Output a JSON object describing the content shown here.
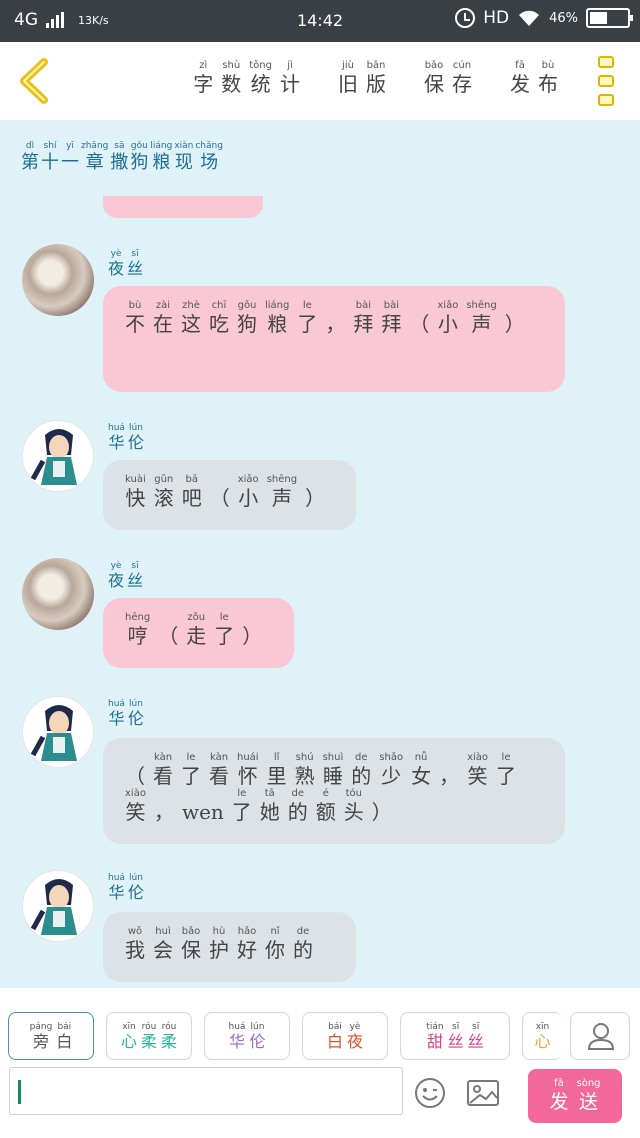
{
  "status": {
    "network": "4G",
    "speed": "13K/s",
    "time": "14:42",
    "hd": "HD",
    "battery": "46%",
    "battery_level": 0.46
  },
  "header": {
    "actions": [
      {
        "name": "word-count",
        "chars": [
          [
            "字",
            "zì"
          ],
          [
            "数",
            "shù"
          ],
          [
            "统",
            "tǒng"
          ],
          [
            "计",
            "jì"
          ]
        ]
      },
      {
        "name": "old-version",
        "chars": [
          [
            "旧",
            "jiù"
          ],
          [
            "版",
            "bǎn"
          ]
        ]
      },
      {
        "name": "save",
        "chars": [
          [
            "保",
            "bǎo"
          ],
          [
            "存",
            "cún"
          ]
        ]
      },
      {
        "name": "publish",
        "chars": [
          [
            "发",
            "fā"
          ],
          [
            "布",
            "bù"
          ]
        ]
      }
    ]
  },
  "chapter": {
    "chars": [
      [
        "第",
        "dì"
      ],
      [
        "十",
        "shí"
      ],
      [
        "一",
        "yī"
      ],
      [
        "章",
        "zhāng"
      ],
      [
        "撒",
        "sā"
      ],
      [
        "狗",
        "gǒu"
      ],
      [
        "粮",
        "liáng"
      ],
      [
        "现",
        "xiàn"
      ],
      [
        "场",
        "chǎng"
      ]
    ]
  },
  "messages": [
    {
      "speaker": "yesi",
      "name": [
        [
          "夜",
          "yè"
        ],
        [
          "丝",
          "sī"
        ]
      ],
      "text": [
        [
          "不",
          "bù"
        ],
        [
          "在",
          "zài"
        ],
        [
          "这",
          "zhè"
        ],
        [
          "吃",
          "chī"
        ],
        [
          "狗",
          "gǒu"
        ],
        [
          "粮",
          "liáng"
        ],
        [
          "了",
          "le"
        ],
        [
          "，",
          ""
        ],
        [
          "拜",
          "bài"
        ],
        [
          "拜",
          "bài"
        ],
        [
          "（",
          ""
        ],
        [
          "小",
          "xiǎo"
        ],
        [
          "声",
          "shēng"
        ],
        [
          "）",
          ""
        ]
      ]
    },
    {
      "speaker": "hualun",
      "name": [
        [
          "华",
          "huá"
        ],
        [
          "伦",
          "lún"
        ]
      ],
      "text": [
        [
          "快",
          "kuài"
        ],
        [
          "滚",
          "gǔn"
        ],
        [
          "吧",
          "bā"
        ],
        [
          "（",
          ""
        ],
        [
          "小",
          "xiǎo"
        ],
        [
          "声",
          "shēng"
        ],
        [
          "）",
          ""
        ]
      ]
    },
    {
      "speaker": "yesi",
      "name": [
        [
          "夜",
          "yè"
        ],
        [
          "丝",
          "sī"
        ]
      ],
      "text": [
        [
          "哼",
          "hēng"
        ],
        [
          "（",
          ""
        ],
        [
          "走",
          "zǒu"
        ],
        [
          "了",
          "le"
        ],
        [
          "）",
          ""
        ]
      ]
    },
    {
      "speaker": "hualun",
      "name": [
        [
          "华",
          "huá"
        ],
        [
          "伦",
          "lún"
        ]
      ],
      "text": [
        [
          "（",
          ""
        ],
        [
          "看",
          "kàn"
        ],
        [
          "了",
          "le"
        ],
        [
          "看",
          "kàn"
        ],
        [
          "怀",
          "huái"
        ],
        [
          "里",
          "lǐ"
        ],
        [
          "熟",
          "shú"
        ],
        [
          "睡",
          "shuì"
        ],
        [
          "的",
          "de"
        ],
        [
          "少",
          "shǎo"
        ],
        [
          "女",
          "nǚ"
        ],
        [
          "，",
          ""
        ],
        [
          "笑",
          "xiào"
        ],
        [
          "了",
          "le"
        ],
        [
          "笑",
          "xiào"
        ],
        [
          "，",
          ""
        ],
        [
          "wen",
          ""
        ],
        [
          "了",
          "le"
        ],
        [
          "她",
          "tā"
        ],
        [
          "的",
          "de"
        ],
        [
          "额",
          "é"
        ],
        [
          "头",
          "tóu"
        ],
        [
          "）",
          ""
        ]
      ]
    },
    {
      "speaker": "hualun",
      "name": [
        [
          "华",
          "huá"
        ],
        [
          "伦",
          "lún"
        ]
      ],
      "text": [
        [
          "我",
          "wǒ"
        ],
        [
          "会",
          "huì"
        ],
        [
          "保",
          "bǎo"
        ],
        [
          "护",
          "hù"
        ],
        [
          "好",
          "hǎo"
        ],
        [
          "你",
          "nǐ"
        ],
        [
          "的",
          "de"
        ]
      ]
    }
  ],
  "toolbar": {
    "chips": [
      {
        "name": "narration",
        "color": "#555555",
        "chars": [
          [
            "旁",
            "páng"
          ],
          [
            "白",
            "bái"
          ]
        ]
      },
      {
        "name": "xin-rou-rou",
        "color": "#27b5a0",
        "chars": [
          [
            "心",
            "xīn"
          ],
          [
            "柔",
            "róu"
          ],
          [
            "柔",
            "róu"
          ]
        ]
      },
      {
        "name": "hua-lun",
        "color": "#9a6ad0",
        "chars": [
          [
            "华",
            "huá"
          ],
          [
            "伦",
            "lún"
          ]
        ]
      },
      {
        "name": "bai-ye",
        "color": "#d9532c",
        "chars": [
          [
            "白",
            "bái"
          ],
          [
            "夜",
            "yè"
          ]
        ]
      },
      {
        "name": "tian-si-si",
        "color": "#e0408a",
        "chars": [
          [
            "甜",
            "tián"
          ],
          [
            "丝",
            "sī"
          ],
          [
            "丝",
            "sī"
          ]
        ]
      },
      {
        "name": "partial",
        "color": "#e8a640",
        "chars": [
          [
            "心",
            "xīn"
          ]
        ]
      }
    ],
    "send": [
      [
        "发",
        "fā"
      ],
      [
        "送",
        "sòng"
      ]
    ],
    "input_value": ""
  },
  "colors": {
    "accent": "#f2689a",
    "pink_bubble": "#f9c8d4",
    "grey_bubble": "#dde2e7",
    "background": "#dff2f8",
    "title": "#1e6e96"
  }
}
